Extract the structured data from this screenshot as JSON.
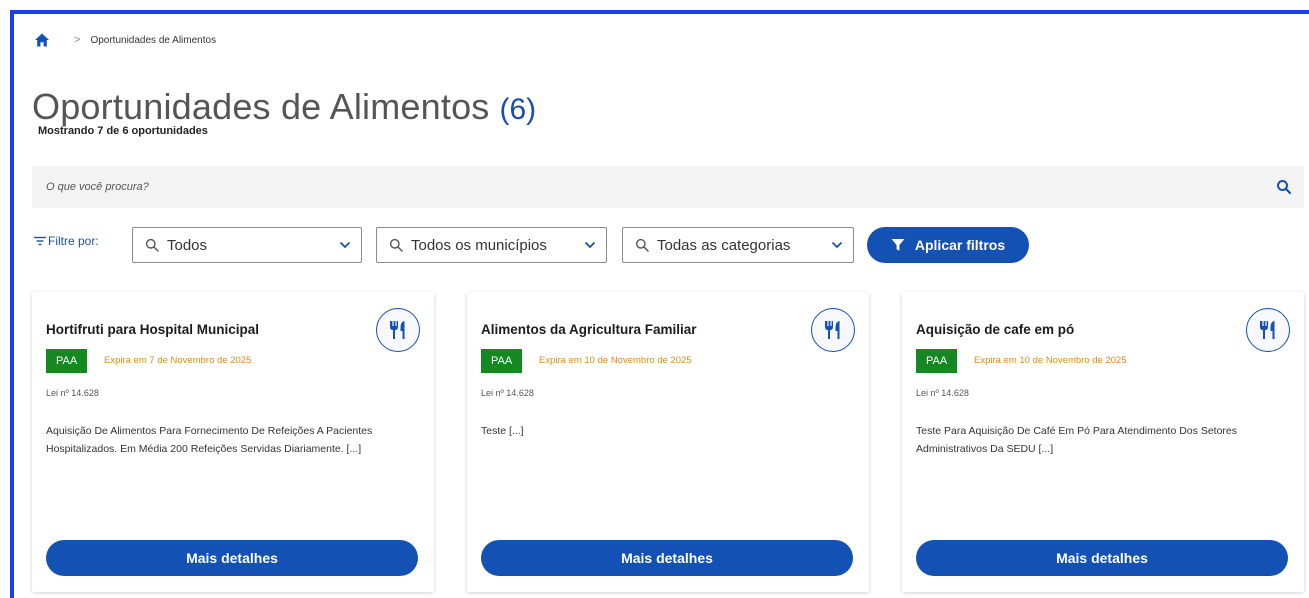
{
  "breadcrumb": {
    "home_icon": "home-icon",
    "separator": ">",
    "current": "Oportunidades de Alimentos"
  },
  "header": {
    "title": "Oportunidades de Alimentos",
    "count": "(6)",
    "subtitle": "Mostrando 7 de 6 oportunidades"
  },
  "search": {
    "placeholder": "O que você procura?",
    "icon": "search-icon"
  },
  "filters": {
    "label": "Filtre por:",
    "selects": [
      {
        "value": "Todos"
      },
      {
        "value": "Todos os municípios"
      },
      {
        "value": "Todas as categorias"
      }
    ],
    "apply_label": "Aplicar filtros"
  },
  "cards": [
    {
      "title": "Hortifruti para Hospital Municipal",
      "badge": "PAA",
      "expiry": "Expira em 7 de Novembro de 2025",
      "law": "Lei nº 14.628",
      "description": "Aquisição De Alimentos Para Fornecimento De Refeições A Pacientes Hospitalizados. Em Média 200 Refeições Servidas Diariamente. [...]",
      "button": "Mais detalhes",
      "icon": "utensils-icon"
    },
    {
      "title": "Alimentos da Agricultura Familiar",
      "badge": "PAA",
      "expiry": "Expira em 10 de Novembro de 2025",
      "law": "Lei nº 14.628",
      "description": "Teste [...]",
      "button": "Mais detalhes",
      "icon": "utensils-icon"
    },
    {
      "title": "Aquisição de cafe em pó",
      "badge": "PAA",
      "expiry": "Expira em 10 de Novembro de 2025",
      "law": "Lei nº 14.628",
      "description": "Teste Para Aquisição De Café Em Pó Para Atendimento Dos Setores Administrativos Da SEDU [...]",
      "button": "Mais detalhes",
      "icon": "utensils-icon"
    }
  ],
  "colors": {
    "primary": "#1351b4",
    "badge_green": "#168821",
    "expiry_orange": "#e08a1e",
    "frame_blue": "#1a3ff0"
  }
}
